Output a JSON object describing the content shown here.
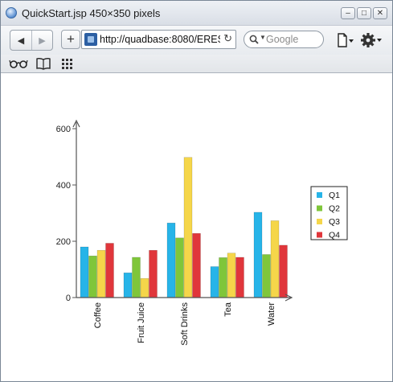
{
  "window": {
    "title": "QuickStart.jsp 450×350 pixels",
    "controls": [
      "minimize",
      "maximize",
      "close"
    ]
  },
  "navbar": {
    "back_icon": "back-arrow-icon",
    "forward_icon": "forward-arrow-icon",
    "new_tab_label": "+",
    "url": "http://quadbase:8080/ERES",
    "search_placeholder": "Google"
  },
  "bookmarks_bar": {
    "icons": [
      "glasses-icon",
      "book-icon",
      "apps-grid-icon"
    ]
  },
  "chart_data": {
    "type": "bar",
    "categories": [
      "Coffee",
      "Fruit Juice",
      "Soft Drinks",
      "Tea",
      "Water"
    ],
    "series": [
      {
        "name": "Q1",
        "color": "#27b4e8",
        "values": [
          180,
          88,
          265,
          110,
          303
        ]
      },
      {
        "name": "Q2",
        "color": "#7fc63a",
        "values": [
          148,
          143,
          212,
          142,
          153
        ]
      },
      {
        "name": "Q3",
        "color": "#f5d64a",
        "values": [
          168,
          68,
          498,
          158,
          273
        ]
      },
      {
        "name": "Q4",
        "color": "#e0363b",
        "values": [
          193,
          168,
          228,
          143,
          186
        ]
      }
    ],
    "yticks": [
      0,
      200,
      400,
      600
    ],
    "ylim": [
      0,
      600
    ],
    "title": "",
    "xlabel": "",
    "ylabel": "",
    "legend_position": "right",
    "grid": false
  }
}
